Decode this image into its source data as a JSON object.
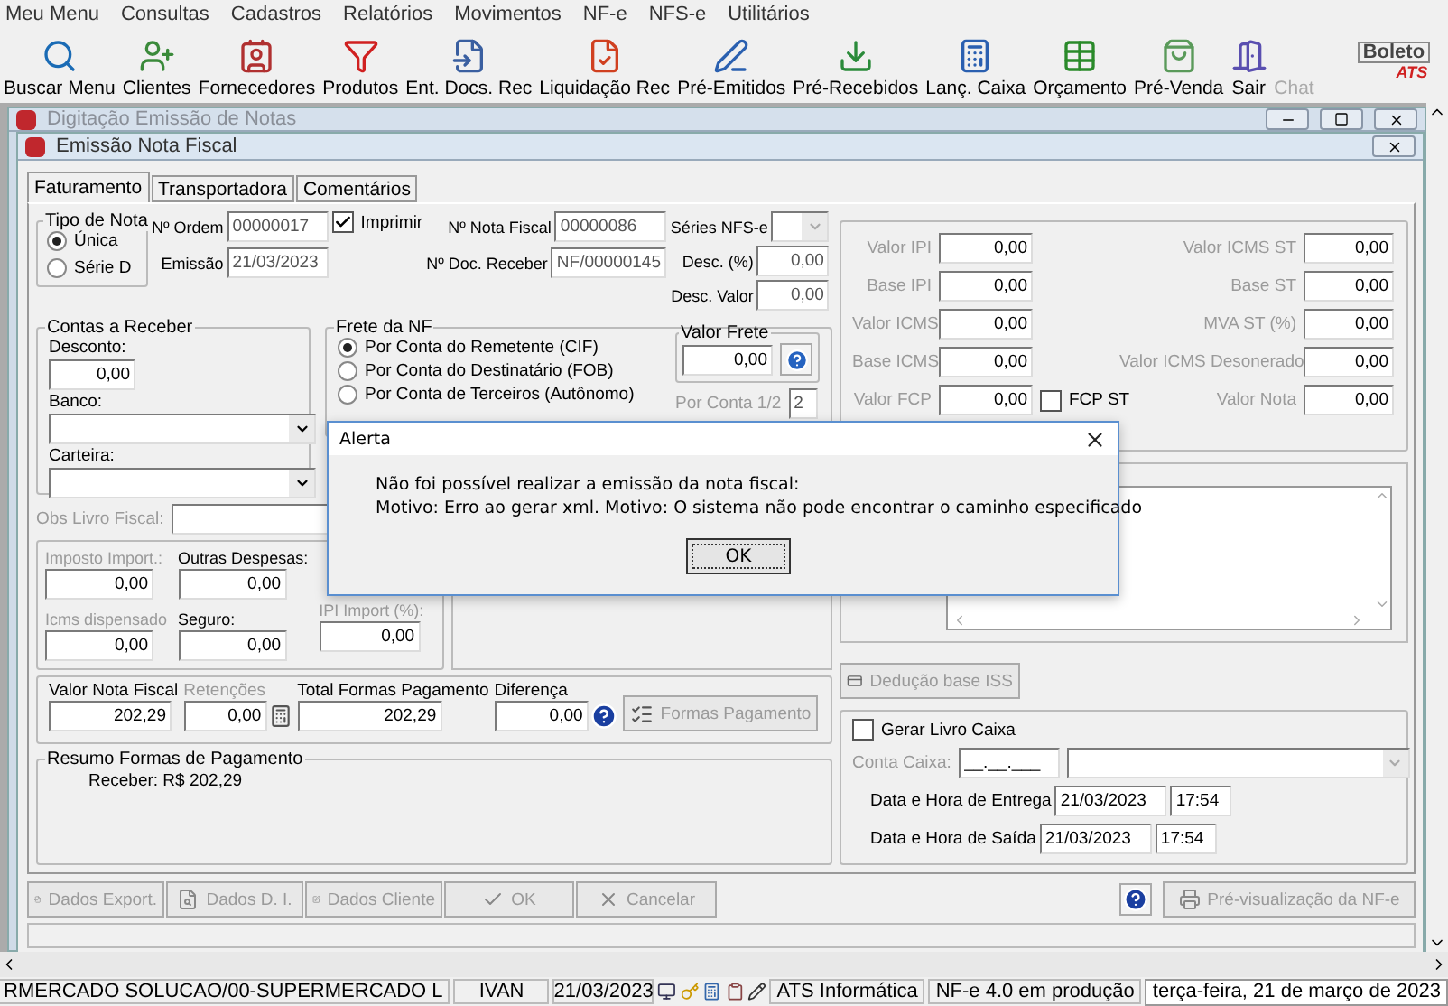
{
  "menu": [
    "Meu Menu",
    "Consultas",
    "Cadastros",
    "Relatórios",
    "Movimentos",
    "NF-e",
    "NFS-e",
    "Utilitários"
  ],
  "toolbar": [
    {
      "label": "Buscar Menu",
      "disabled": false
    },
    {
      "label": "Clientes",
      "disabled": false
    },
    {
      "label": "Fornecedores",
      "disabled": false
    },
    {
      "label": "Produtos",
      "disabled": false
    },
    {
      "label": "Ent. Docs. Rec",
      "disabled": false
    },
    {
      "label": "Liquidação Rec",
      "disabled": false
    },
    {
      "label": "Pré-Emitidos",
      "disabled": false
    },
    {
      "label": "Pré-Recebidos",
      "disabled": false
    },
    {
      "label": "Lanç. Caixa",
      "disabled": false
    },
    {
      "label": "Orçamento",
      "disabled": false
    },
    {
      "label": "Pré-Venda",
      "disabled": false
    },
    {
      "label": "Sair",
      "disabled": false
    },
    {
      "label": "Chat",
      "disabled": true
    }
  ],
  "logo": {
    "text": "Boleto",
    "subtext": "ATS"
  },
  "outer_window": {
    "title": "Digitação Emissão de Notas"
  },
  "window": {
    "title": "Emissão Nota Fiscal"
  },
  "tabs": [
    {
      "label": "Faturamento",
      "selected": true
    },
    {
      "label": "Transportadora",
      "selected": false
    },
    {
      "label": "Comentários",
      "selected": false
    }
  ],
  "tipo_de_nota": {
    "title": "Tipo de Nota",
    "options": [
      {
        "label": "Única",
        "selected": true
      },
      {
        "label": "Série D",
        "selected": false
      }
    ]
  },
  "header": {
    "ordem": {
      "label": "Nº Ordem",
      "value": "00000017"
    },
    "emissao": {
      "label": "Emissão",
      "value": "21/03/2023"
    },
    "imprimir": {
      "label": "Imprimir",
      "checked": true
    },
    "nota": {
      "label": "Nº Nota Fiscal",
      "value": "00000086"
    },
    "doc": {
      "label": "Nº Doc. Receber",
      "value": "NF/00000145"
    },
    "series": {
      "label": "Séries NFS-e"
    },
    "desc_pct": {
      "label": "Desc. (%)",
      "value": "0,00"
    },
    "desc_valor": {
      "label": "Desc. Valor",
      "value": "0,00"
    }
  },
  "taxes": [
    {
      "left": {
        "label": "Valor IPI",
        "value": "0,00"
      },
      "right": {
        "label": "Valor ICMS ST",
        "value": "0,00"
      }
    },
    {
      "left": {
        "label": "Base IPI",
        "value": "0,00"
      },
      "right": {
        "label": "Base ST",
        "value": "0,00"
      }
    },
    {
      "left": {
        "label": "Valor ICMS",
        "value": "0,00"
      },
      "right": {
        "label": "MVA ST (%)",
        "value": "0,00"
      }
    },
    {
      "left": {
        "label": "Base ICMS",
        "value": "0,00"
      },
      "right": {
        "label": "Valor ICMS Desonerado",
        "value": "0,00"
      }
    },
    {
      "left": {
        "label": "Valor FCP",
        "value": "0,00"
      },
      "checkbox": {
        "label": "FCP ST",
        "checked": false
      },
      "right": {
        "label": "Valor Nota",
        "value": "0,00"
      }
    }
  ],
  "contas": {
    "title": "Contas a Receber",
    "desconto": {
      "label": "Desconto:",
      "value": "0,00"
    },
    "banco": {
      "label": "Banco:"
    },
    "carteira": {
      "label": "Carteira:"
    }
  },
  "frete": {
    "title": "Frete da NF",
    "options": [
      {
        "label": "Por Conta do Remetente (CIF)",
        "selected": true
      },
      {
        "label": "Por Conta do Destinatário (FOB)",
        "selected": false
      },
      {
        "label": "Por Conta de Terceiros (Autônomo)",
        "selected": false
      }
    ],
    "valor_frete": {
      "title": "Valor Frete",
      "value": "0,00"
    },
    "por_conta": {
      "label": "Por Conta 1/2",
      "value": "2"
    }
  },
  "obs_livro": {
    "label": "Obs Livro Fiscal:"
  },
  "imports": [
    {
      "label": "Imposto Import.:",
      "value": "0,00",
      "disabled": true
    },
    {
      "label": "Outras Despesas:",
      "value": "0,00",
      "disabled": false
    },
    {
      "label": "Icms dispensado",
      "value": "0,00",
      "disabled": true
    },
    {
      "label": "Seguro:",
      "value": "0,00",
      "disabled": false
    },
    {
      "label": "IPI Import (%):",
      "value": "0,00",
      "disabled": true
    }
  ],
  "totals": [
    {
      "label": "Valor Nota Fiscal",
      "value": "202,29",
      "disabled": false
    },
    {
      "label": "Retenções",
      "value": "0,00",
      "disabled": true
    },
    {
      "label": "Total Formas Pagamento",
      "value": "202,29",
      "disabled": false
    },
    {
      "label": "Diferença",
      "value": "0,00",
      "disabled": false
    }
  ],
  "formas_button": {
    "label": "Formas Pagamento",
    "disabled": true
  },
  "resumo": {
    "title": "Resumo Formas de Pagamento",
    "line": "Receber: R$ 202,29"
  },
  "deducao_button": {
    "label": "Dedução base ISS",
    "disabled": true
  },
  "livro_caixa": {
    "gerar": {
      "label": "Gerar Livro Caixa",
      "checked": false
    },
    "conta": {
      "label": "Conta Caixa:",
      "value": "__.__.___"
    },
    "entrega": {
      "label": "Data e Hora de Entrega",
      "date": "21/03/2023",
      "time": "17:54"
    },
    "saida": {
      "label": "Data e Hora de Saída",
      "date": "21/03/2023",
      "time": "17:54"
    }
  },
  "bottom_buttons": [
    {
      "label": "Dados Export.",
      "disabled": true
    },
    {
      "label": "Dados D. I.",
      "disabled": true
    },
    {
      "label": "Dados Cliente",
      "disabled": true
    },
    {
      "label": "OK",
      "disabled": true
    },
    {
      "label": "Cancelar",
      "disabled": true
    }
  ],
  "preview_button": {
    "label": "Pré-visualização da NF-e",
    "disabled": true
  },
  "dialog": {
    "title": "Alerta",
    "lines": [
      "Não foi possível realizar a emissão da nota fiscal:",
      "Motivo: Erro ao gerar xml. Motivo: O sistema não pode encontrar o caminho especificado"
    ],
    "button": "OK"
  },
  "status_bar": {
    "company": "RMERCADO SOLUCAO/00-SUPERMERCADO L",
    "user": "IVAN",
    "date": "21/03/2023",
    "vendor": "ATS Informática",
    "mode": "NF-e 4.0 em produção",
    "clock": "terça-feira, 21 de março de 2023"
  }
}
